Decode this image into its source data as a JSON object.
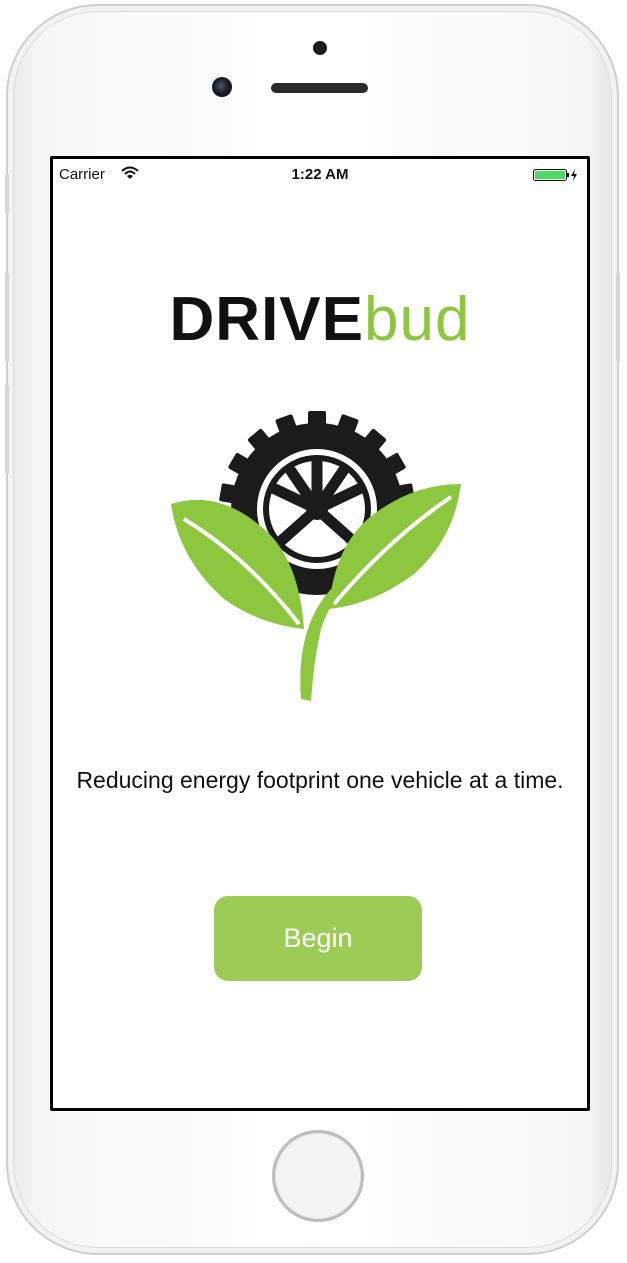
{
  "status_bar": {
    "carrier": "Carrier",
    "time": "1:22 AM",
    "wifi_icon": "wifi-icon",
    "battery_icon": "battery-charging-icon",
    "battery_color": "#4cd964"
  },
  "app": {
    "logo_part1": "DRIVE",
    "logo_part2": "bud",
    "emblem_icon": "tire-with-leaves-icon",
    "tagline": "Reducing energy footprint one vehicle at a time.",
    "begin_label": "Begin"
  },
  "colors": {
    "brand_green": "#8dc63f",
    "button_green": "#9ccc55",
    "dark": "#111111"
  }
}
